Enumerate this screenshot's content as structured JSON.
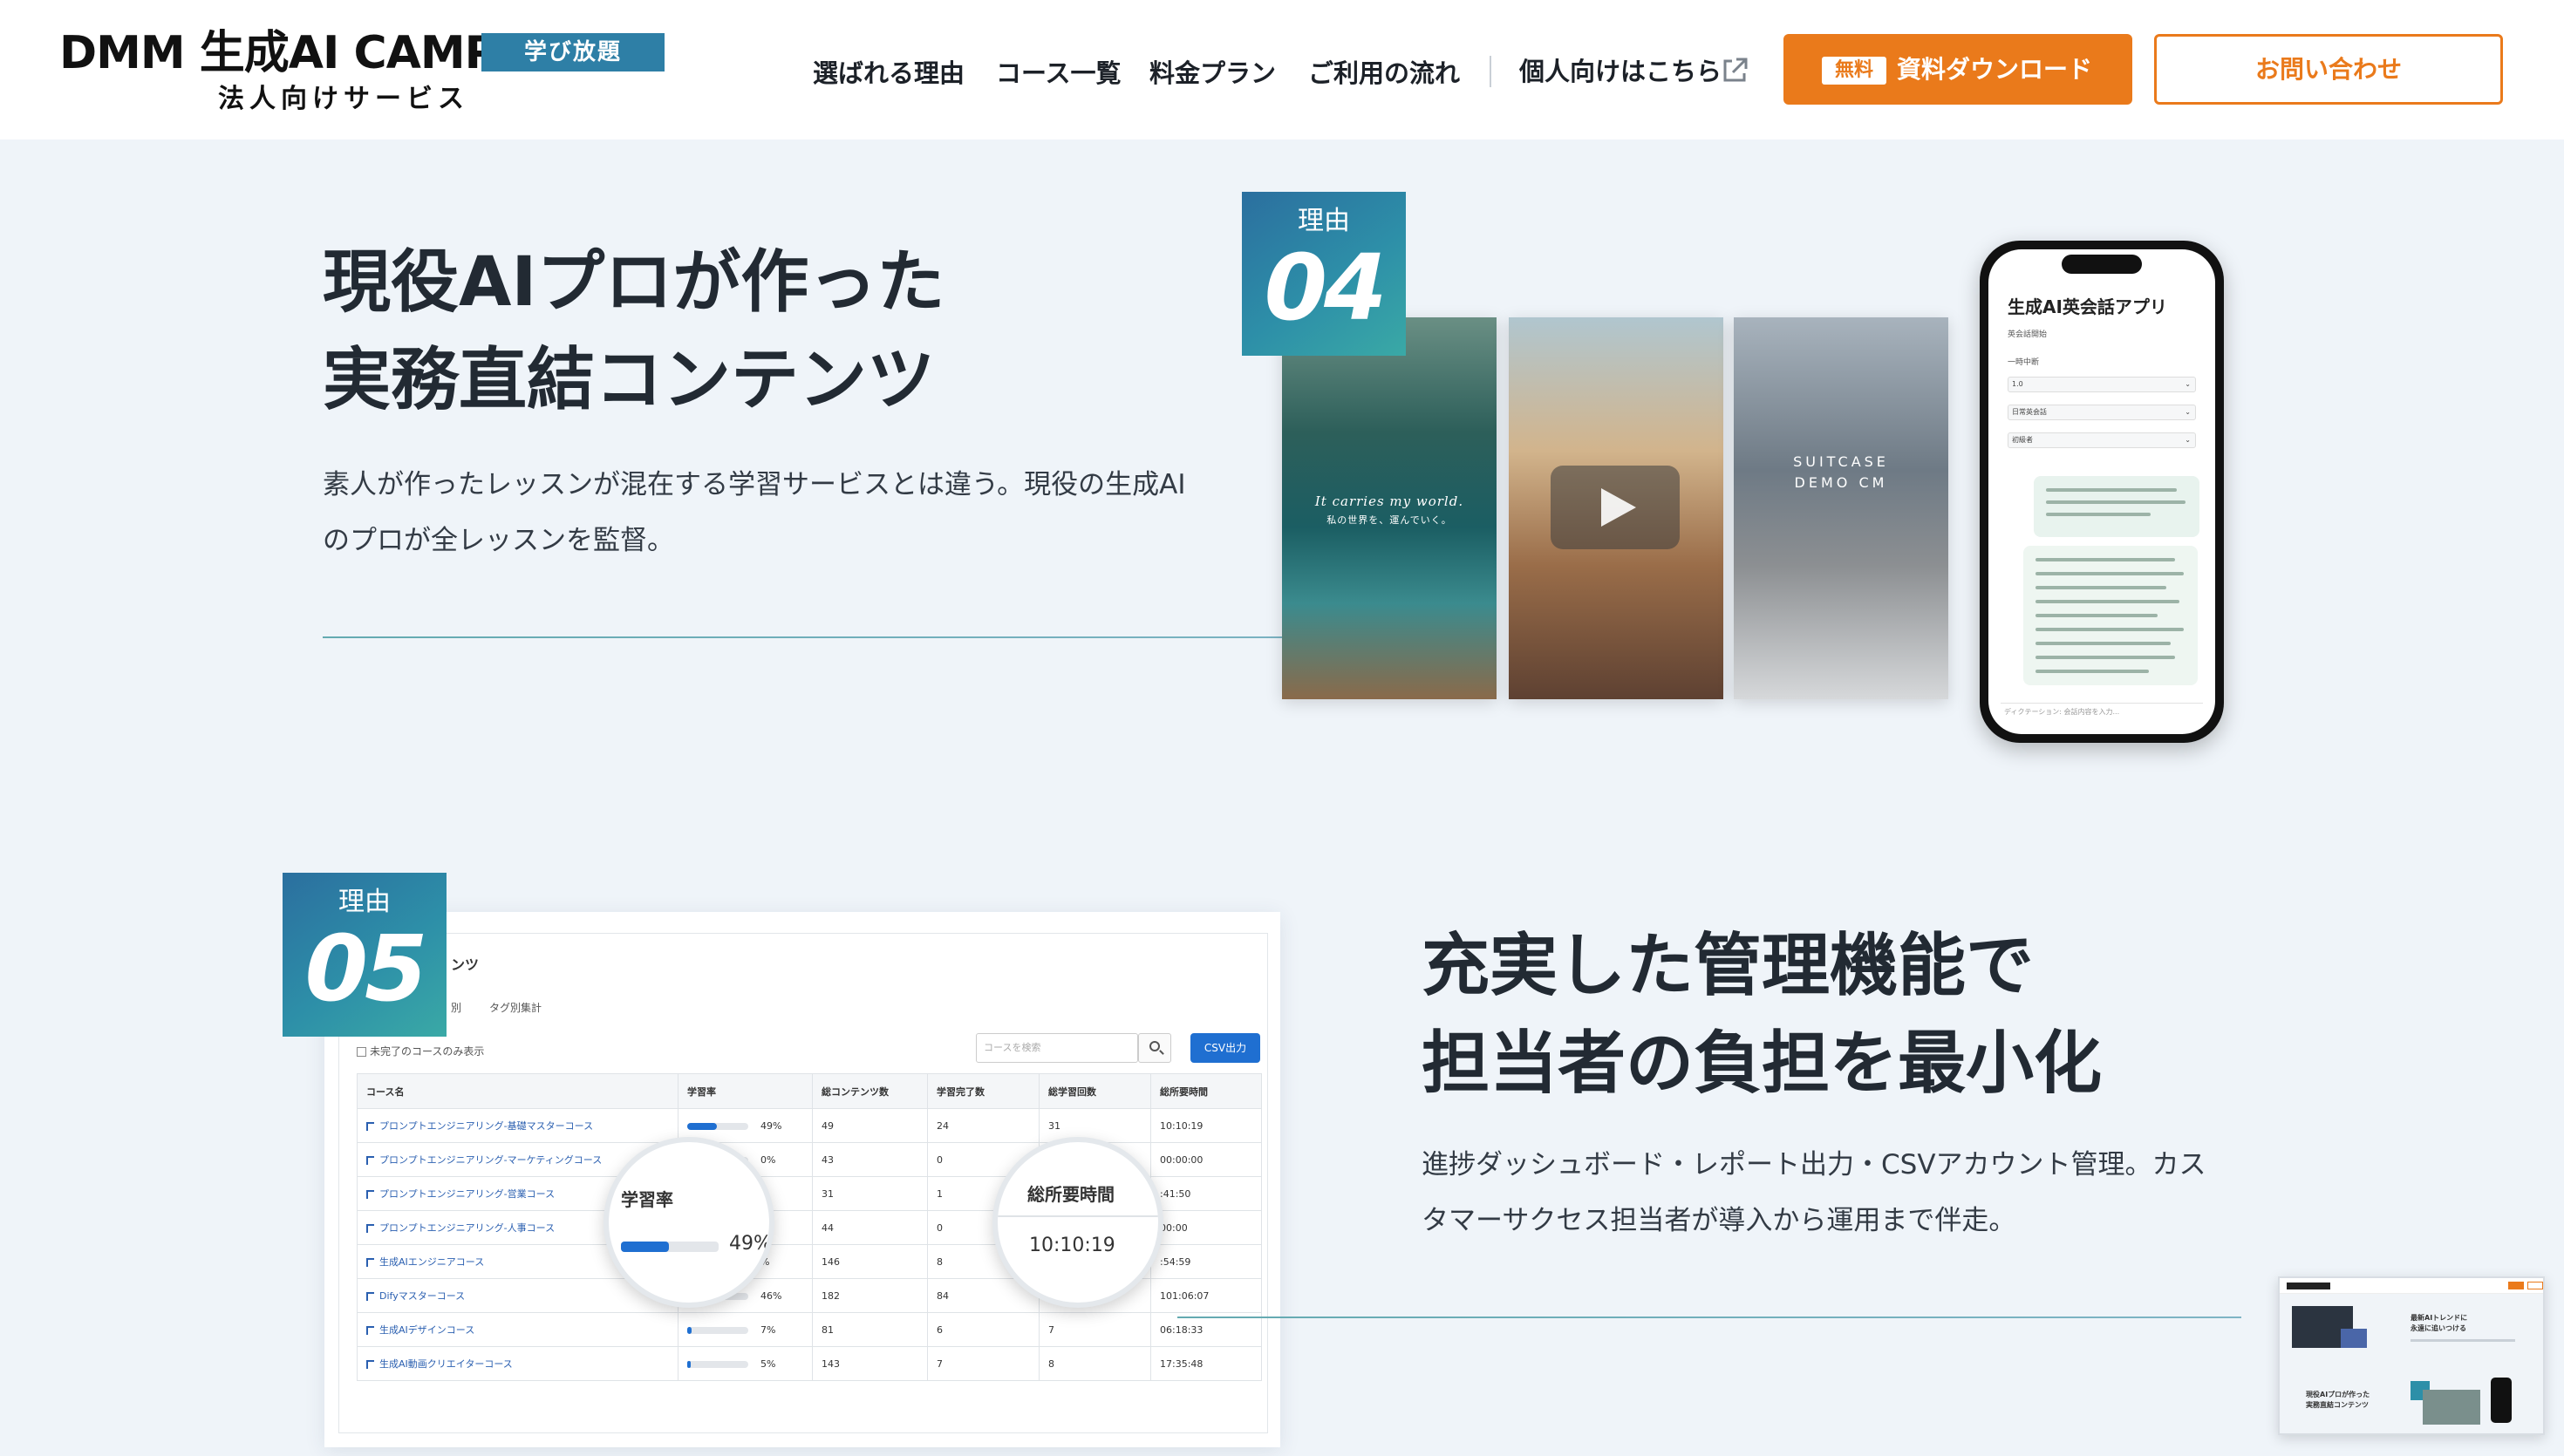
{
  "header": {
    "logo_main": "DMM 生成AI CAMP",
    "logo_badge": "学び放題",
    "logo_sub": "法人向けサービス",
    "nav": [
      {
        "label": "選ばれる理由"
      },
      {
        "label": "コース一覧"
      },
      {
        "label": "料金プラン"
      },
      {
        "label": "ご利用の流れ"
      }
    ],
    "external_link": "個人向けはこちら",
    "download_button": {
      "tag": "無料",
      "label": "資料ダウンロード"
    },
    "contact_button": "お問い合わせ",
    "accent_color": "#ea7a1b"
  },
  "reason04": {
    "badge_label": "理由",
    "badge_number": "04",
    "title_line1": "現役AIプロが作った",
    "title_line2": "実務直結コンテンツ",
    "desc_line1": "素人が作ったレッスンが混在する学習サービスとは違う。現役の生成AI",
    "desc_line2": "のプロが全レッスンを監督。",
    "photo_captions": [
      "It carries my world.",
      "私の世界を、運んでいく。",
      "SUITCASE",
      "DEMO CM"
    ],
    "phone": {
      "app_title": "生成AI英会話アプリ",
      "fields": [
        {
          "label": "英会話開始",
          "value": ""
        },
        {
          "label": "一時中断",
          "value": "1.0"
        },
        {
          "label": "",
          "value": "日常英会話"
        },
        {
          "label": "",
          "value": "初級者"
        }
      ],
      "input_placeholder": "ディクテーション: 会話内容を入力..."
    }
  },
  "reason05": {
    "badge_label": "理由",
    "badge_number": "05",
    "title_line1": "充実した管理機能で",
    "title_line2": "担当者の負担を最小化",
    "desc_line1": "進捗ダッシュボード・レポート出力・CSVアカウント管理。カス",
    "desc_line2": "タマーサクセス担当者が導入から運用まで伴走。",
    "dashboard": {
      "title": "ンツ",
      "tabs": [
        "別",
        "タグ別集計"
      ],
      "filter_label": "未完了のコースのみ表示",
      "search_placeholder": "コースを検索",
      "csv_button": "CSV出力",
      "columns": [
        "コース名",
        "学習率",
        "総コンテンツ数",
        "学習完了数",
        "総学習回数",
        "総所要時間"
      ],
      "rows": [
        {
          "name": "プロンプトエンジニアリング-基礎マスターコース",
          "rate": 49,
          "rate_label": "49%",
          "total": "49",
          "done": "24",
          "count": "31",
          "time": "10:10:19"
        },
        {
          "name": "プロンプトエンジニアリング-マーケティングコース",
          "rate": 0,
          "rate_label": "0%",
          "total": "43",
          "done": "0",
          "count": "0",
          "time": "00:00:00"
        },
        {
          "name": "プロンプトエンジニアリング-営業コース",
          "rate": 3,
          "rate_label": "%",
          "total": "31",
          "done": "1",
          "count": "",
          "time": ":41:50"
        },
        {
          "name": "プロンプトエンジニアリング-人事コース",
          "rate": 0,
          "rate_label": "%",
          "total": "44",
          "done": "0",
          "count": "",
          "time": "00:00"
        },
        {
          "name": "生成AIエンジニアコース",
          "rate": 5,
          "rate_label": "%",
          "total": "146",
          "done": "8",
          "count": "",
          "time": ":54:59"
        },
        {
          "name": "Difyマスターコース",
          "rate": 46,
          "rate_label": "46%",
          "total": "182",
          "done": "84",
          "count": "",
          "time": "101:06:07"
        },
        {
          "name": "生成AIデザインコース",
          "rate": 7,
          "rate_label": "7%",
          "total": "81",
          "done": "6",
          "count": "7",
          "time": "06:18:33"
        },
        {
          "name": "生成AI動画クリエイターコース",
          "rate": 5,
          "rate_label": "5%",
          "total": "143",
          "done": "7",
          "count": "8",
          "time": "17:35:48"
        }
      ],
      "lens_rate": {
        "title": "学習率",
        "value": "49%"
      },
      "lens_time": {
        "title": "総所要時間",
        "value": "10:10:19"
      }
    }
  },
  "thumbnail": {
    "text1": "最新AIトレンドに",
    "text2": "永遠に追いつける",
    "text3": "現役AIプロが作った",
    "text4": "実務直結コンテンツ"
  }
}
